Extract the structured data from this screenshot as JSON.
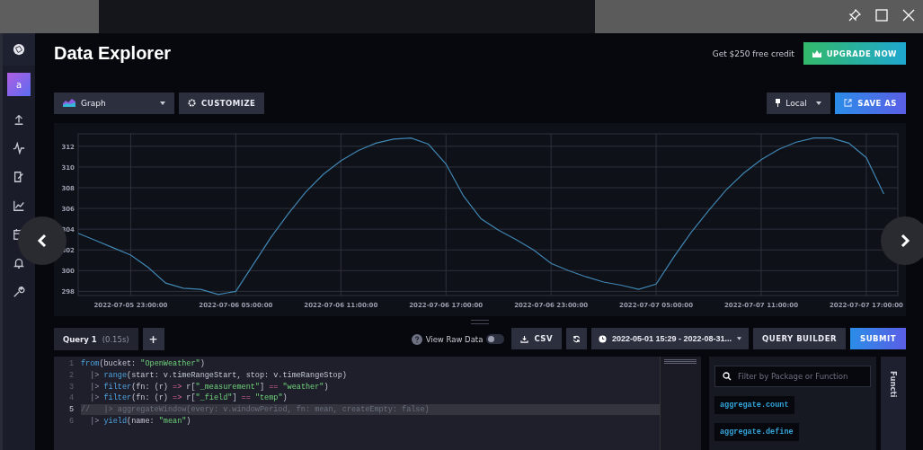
{
  "sidebar": {
    "avatar": "a"
  },
  "header": {
    "title": "Data Explorer",
    "promo": "Get $250 free credit",
    "upgrade_button": "UPGRADE NOW"
  },
  "toolbar": {
    "view_type": "Graph",
    "customize_button": "CUSTOMIZE",
    "timezone": "Local",
    "save_button": "SAVE AS"
  },
  "graph": {
    "chart_data": {
      "type": "line",
      "categories": [
        null,
        null,
        null,
        "2022-07-05 23:00:00",
        null,
        null,
        null,
        null,
        null,
        "2022-07-06 05:00:00",
        null,
        null,
        null,
        null,
        null,
        "2022-07-06 11:00:00",
        null,
        null,
        null,
        null,
        null,
        "2022-07-06 17:00:00",
        null,
        null,
        null,
        null,
        null,
        "2022-07-06 23:00:00",
        null,
        null,
        null,
        null,
        null,
        "2022-07-07 05:00:00",
        null,
        null,
        null,
        null,
        null,
        "2022-07-07 11:00:00",
        null,
        null,
        null,
        null,
        null,
        "2022-07-07 17:00:00",
        null
      ],
      "values": [
        303.6,
        302.9,
        302.2,
        301.5,
        300.3,
        298.8,
        298.3,
        298.2,
        297.7,
        298.0,
        300.6,
        303.2,
        305.5,
        307.6,
        309.3,
        310.6,
        311.6,
        312.3,
        312.7,
        312.8,
        312.2,
        310.3,
        307.2,
        305.0,
        303.9,
        303.0,
        302.0,
        300.7,
        300.0,
        299.4,
        298.9,
        298.6,
        298.2,
        298.7,
        301.3,
        303.7,
        305.8,
        307.8,
        309.4,
        310.7,
        311.7,
        312.4,
        312.8,
        312.8,
        312.3,
        310.9,
        307.4
      ],
      "ylim": [
        297.6,
        313.2
      ],
      "grid": true,
      "yticks": [
        298,
        300,
        302,
        304,
        306,
        308,
        310,
        312
      ]
    }
  },
  "query_bar": {
    "tabs": [
      {
        "label": "Query 1",
        "timing": "(0.15s)",
        "selected": true
      }
    ],
    "add_button": "+",
    "raw_data_label": "View Raw Data",
    "raw_data_on": false,
    "csv_button": "CSV",
    "time_range": "2022-05-01 15:29 - 2022-08-31...",
    "query_builder_button": "QUERY BUILDER",
    "submit_button": "SUBMIT"
  },
  "editor": {
    "lines": [
      {
        "number": "1",
        "highlighted": false,
        "tokens": [
          {
            "text": "from",
            "kind": "fn"
          },
          {
            "text": "(bucket: ",
            "kind": "plain"
          },
          {
            "text": "\"OpenWeather\"",
            "kind": "string"
          },
          {
            "text": ")",
            "kind": "plain"
          }
        ]
      },
      {
        "number": "2",
        "highlighted": false,
        "tokens": [
          {
            "text": "  |> ",
            "kind": "pipe"
          },
          {
            "text": "range",
            "kind": "fn"
          },
          {
            "text": "(start: v.timeRangeStart, stop: v.timeRangeStop)",
            "kind": "plain"
          }
        ]
      },
      {
        "number": "3",
        "highlighted": false,
        "tokens": [
          {
            "text": "  |> ",
            "kind": "pipe"
          },
          {
            "text": "filter",
            "kind": "fn"
          },
          {
            "text": "(fn: (r) ",
            "kind": "plain"
          },
          {
            "text": "=>",
            "kind": "op"
          },
          {
            "text": " r[",
            "kind": "plain"
          },
          {
            "text": "\"_measurement\"",
            "kind": "string"
          },
          {
            "text": "] ",
            "kind": "plain"
          },
          {
            "text": "==",
            "kind": "op"
          },
          {
            "text": " \"weather\"",
            "kind": "string"
          },
          {
            "text": ")",
            "kind": "plain"
          }
        ]
      },
      {
        "number": "4",
        "highlighted": false,
        "tokens": [
          {
            "text": "  |> ",
            "kind": "pipe"
          },
          {
            "text": "filter",
            "kind": "fn"
          },
          {
            "text": "(fn: (r) ",
            "kind": "plain"
          },
          {
            "text": "=>",
            "kind": "op"
          },
          {
            "text": " r[",
            "kind": "plain"
          },
          {
            "text": "\"_field\"",
            "kind": "string"
          },
          {
            "text": "] ",
            "kind": "plain"
          },
          {
            "text": "==",
            "kind": "op"
          },
          {
            "text": " \"temp\"",
            "kind": "string"
          },
          {
            "text": ")",
            "kind": "plain"
          }
        ]
      },
      {
        "number": "5",
        "highlighted": true,
        "tokens": [
          {
            "text": "//   |> aggregateWindow(every: v.windowPeriod, fn: mean, createEmpty: false)",
            "kind": "comment"
          }
        ]
      },
      {
        "number": "6",
        "highlighted": false,
        "tokens": [
          {
            "text": "  |> ",
            "kind": "pipe"
          },
          {
            "text": "yield",
            "kind": "fn"
          },
          {
            "text": "(name: ",
            "kind": "plain"
          },
          {
            "text": "\"mean\"",
            "kind": "string"
          },
          {
            "text": ")",
            "kind": "plain"
          }
        ]
      }
    ]
  },
  "functions_panel": {
    "search": {
      "placeholder": "Filter by Package or Function"
    },
    "items": [
      "aggregate.count",
      "aggregate.define"
    ],
    "tab_label": "Functi"
  }
}
